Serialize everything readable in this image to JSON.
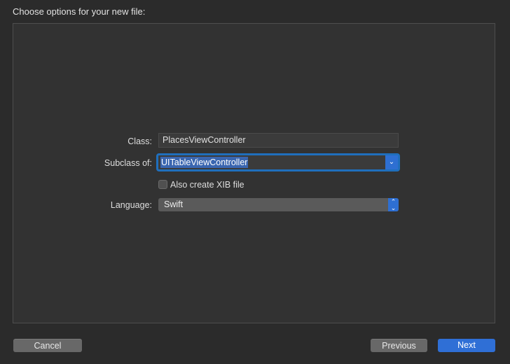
{
  "dialog": {
    "heading": "Choose options for your new file:"
  },
  "form": {
    "class_label": "Class:",
    "class_value": "PlacesViewController",
    "subclass_label": "Subclass of:",
    "subclass_value": "UITableViewController",
    "xib_checkbox_label": "Also create XIB file",
    "xib_checked": false,
    "language_label": "Language:",
    "language_value": "Swift"
  },
  "buttons": {
    "cancel": "Cancel",
    "previous": "Previous",
    "next": "Next"
  },
  "colors": {
    "accent": "#2f6fd6",
    "focus_ring": "#1f6fbd",
    "background": "#2b2b2b",
    "panel": "#323232"
  },
  "icons": {
    "subclass_dropdown": "chevron-down-icon",
    "language_popup": "up-down-chevron-icon"
  }
}
